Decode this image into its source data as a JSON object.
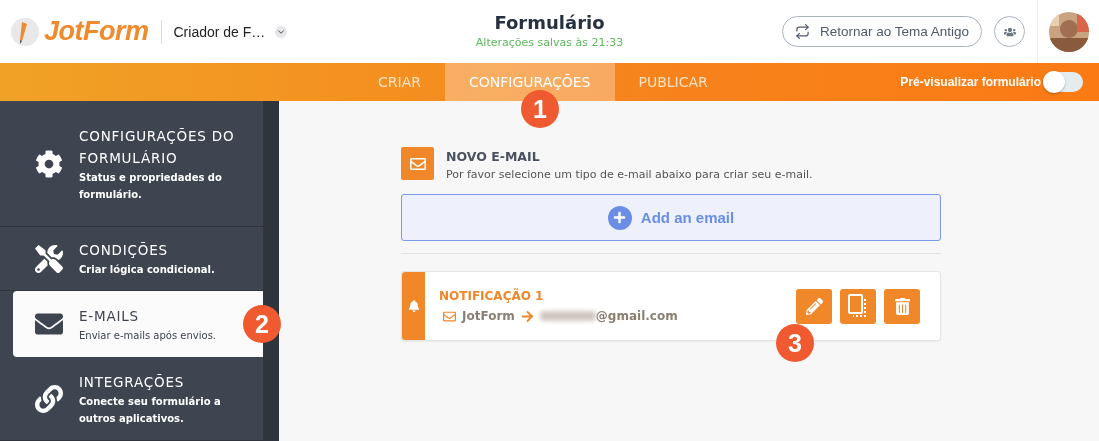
{
  "header": {
    "logo": "JotForm",
    "form_menu": "Criador de F…",
    "title": "Formulário",
    "saved_status": "Alterações salvas às 21:33",
    "theme_button": "Retornar ao Tema Antigo"
  },
  "nav": {
    "tabs": [
      {
        "label": "CRIAR",
        "selected": false
      },
      {
        "label": "CONFIGURAÇÕES",
        "selected": true,
        "callout": "1"
      },
      {
        "label": "PUBLICAR",
        "selected": false
      }
    ],
    "preview": {
      "label": "Pré-visualizar formulário",
      "on": false
    }
  },
  "sidebar": {
    "items": [
      {
        "kind": "gear",
        "title": "CONFIGURAÇÕES DO FORMULÁRIO",
        "subtitle": "Status e propriedades do formulário.",
        "selected": false
      },
      {
        "kind": "tools",
        "title": "CONDIÇÕES",
        "subtitle": "Criar lógica condicional.",
        "selected": false
      },
      {
        "kind": "envelope",
        "title": "E-MAILS",
        "subtitle": "Enviar e-mails após envios.",
        "selected": true,
        "callout": "2"
      },
      {
        "kind": "link",
        "title": "INTEGRAÇÕES",
        "subtitle": "Conecte seu formulário a outros aplicativos.",
        "selected": false
      }
    ]
  },
  "new_email": {
    "title": "NOVO E-MAIL",
    "description": "Por favor selecione um tipo de e-mail abaixo para criar seu e-mail.",
    "add_button": "Add an email"
  },
  "notifications": [
    {
      "title": "NOTIFICAÇÃO 1",
      "sender": "JotForm",
      "recipient": "@gmail.com",
      "recipient_redacted": true,
      "edit_callout": "3"
    }
  ]
}
